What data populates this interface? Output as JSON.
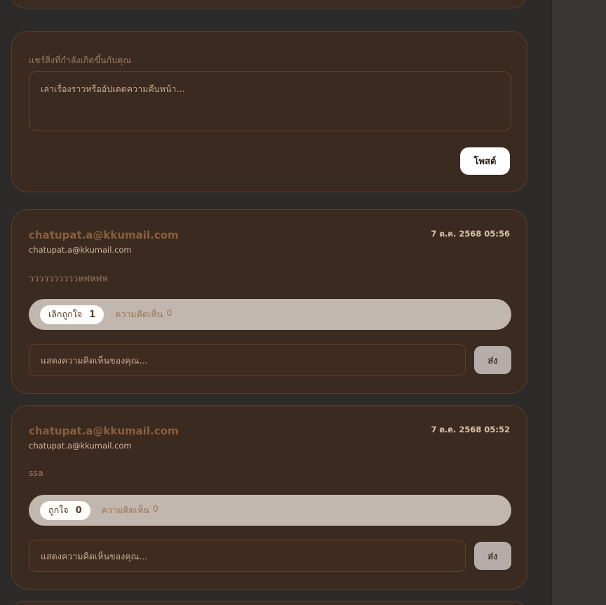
{
  "composer": {
    "label": "แชร์สิ่งที่กำลังเกิดขึ้นกับคุณ",
    "placeholder": "เล่าเรื่องราวหรืออัปเดตความคืบหน้า...",
    "post_label": "โพสต์"
  },
  "posts": [
    {
      "author": "chatupat.a@kkumail.com",
      "author_sub": "chatupat.a@kkumail.com",
      "timestamp": "7 ต.ค. 2568 05:56",
      "body": "ววววววววววหฟหฟห",
      "like_label": "เลิกถูกใจ",
      "like_count": "1",
      "liked": true,
      "comment_label": "ความคิดเห็น",
      "comment_count": "0",
      "comment_placeholder": "แสดงความคิดเห็นของคุณ...",
      "send_label": "ส่ง"
    },
    {
      "author": "chatupat.a@kkumail.com",
      "author_sub": "chatupat.a@kkumail.com",
      "timestamp": "7 ต.ค. 2568 05:52",
      "body": "ssa",
      "like_label": "ถูกใจ",
      "like_count": "0",
      "liked": false,
      "comment_label": "ความคิดเห็น",
      "comment_count": "0",
      "comment_placeholder": "แสดงความคิดเห็นของคุณ...",
      "send_label": "ส่ง"
    }
  ],
  "colors": {
    "card_bg": "#3a2a20",
    "card_border": "#5a3f2c",
    "accent_author": "#8b5e3e",
    "reaction_bar": "#c2b7ae",
    "page_bg": "#2d2b2a"
  }
}
